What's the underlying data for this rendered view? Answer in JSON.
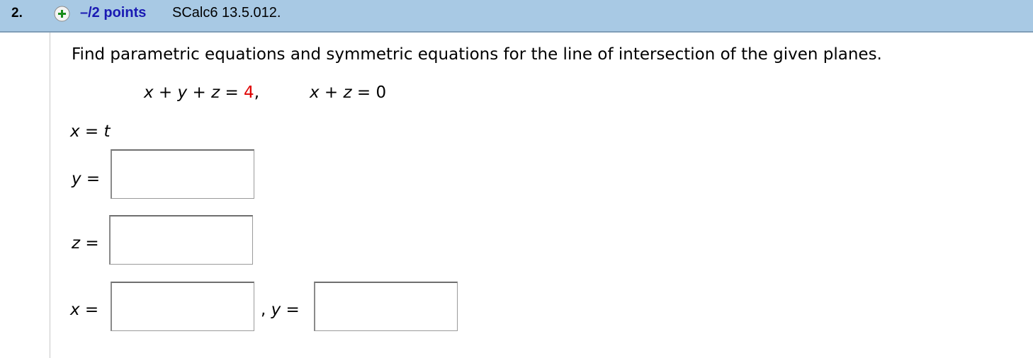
{
  "header": {
    "question_number": "2.",
    "points": "–/2 points",
    "reference": "SCalc6 13.5.012."
  },
  "problem": {
    "prompt": "Find parametric equations and symmetric equations for the line of intersection of the given planes.",
    "plane1": {
      "lhs_x": "x",
      "plus1": " + ",
      "lhs_y": "y",
      "plus2": " + ",
      "lhs_z": "z",
      "equals": " = ",
      "rhs": "4",
      "comma": ","
    },
    "plane2": {
      "lhs_x": "x",
      "plus": " + ",
      "lhs_z": "z",
      "equals": " = ",
      "rhs": "0"
    }
  },
  "parametric": {
    "x_var": "x",
    "x_equals": " = ",
    "x_param": "t",
    "y_label_var": "y",
    "y_label_eq": " =",
    "y_value": "",
    "z_label_var": "z",
    "z_label_eq": " =",
    "z_value": ""
  },
  "symmetric": {
    "x_label_var": "x",
    "x_label_eq": " =",
    "x_value": "",
    "separator": ", ",
    "y_label_var": "y",
    "y_label_eq": " =",
    "y_value": ""
  },
  "colors": {
    "header_bg": "#a8c9e4",
    "points_color": "#1a1ab3",
    "highlight_red": "#e00000",
    "plus_icon_green": "#1a8c1a"
  }
}
